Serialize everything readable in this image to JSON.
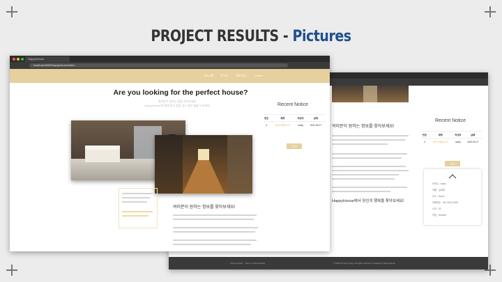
{
  "slide": {
    "title_main": "PROJECT RESULTS -",
    "title_highlight": "Pictures"
  },
  "window1": {
    "tab_label": "HappyHouse",
    "url": "localhost:8080/happyhouse/index",
    "nav": [
      "공지사항",
      "로그인",
      "회원가입",
      "Home"
    ],
    "headline": "Are you looking for the perfect house?",
    "subtext": [
      "여러분이 원하는 집을 찾아보세요",
      "HappyHouse와 함께 좋은 집을 찾고 좋은 삶을 누리세요"
    ],
    "notice_title": "Recent Notice",
    "table_headers": [
      "번호",
      "제목",
      "작성자",
      "날짜"
    ],
    "table_row": [
      "4",
      "공지사항입니다",
      "ssafy",
      "2020.05.27"
    ],
    "more_button": "더보기",
    "korean_heading": "여러분이 원하는 정보를 찾아보세요!"
  },
  "window2": {
    "korean_heading": "여러분이 원하는 정보를 찾아보세요!",
    "korean_heading2": "HappyHouse에서 당신의 행복을 찾아보세요!",
    "notice_title": "Recent Notice",
    "table_headers": [
      "번호",
      "제목",
      "작성자",
      "날짜"
    ],
    "table_row": [
      "4",
      "공지사항입니다",
      "ssafy",
      "2020.05.27"
    ],
    "more_button": "더보기",
    "profile": [
      "아이디 : ssafy",
      "이름 : 김싸피",
      "주소 : Seoul",
      "전화번호 : 010-0000-0000",
      "나이 : 25",
      "직업 : Student"
    ],
    "footer_links": [
      "Privacy Policy",
      "Terms of Service",
      "FAQ"
    ],
    "footer_copy": "© 2020 Privacy Policy. All rights reserved. Created by HappyHouse"
  },
  "colors": {
    "nav": "#e5d09e",
    "title_highlight": "#1f4e8c",
    "footer": "#3a3a3a"
  }
}
